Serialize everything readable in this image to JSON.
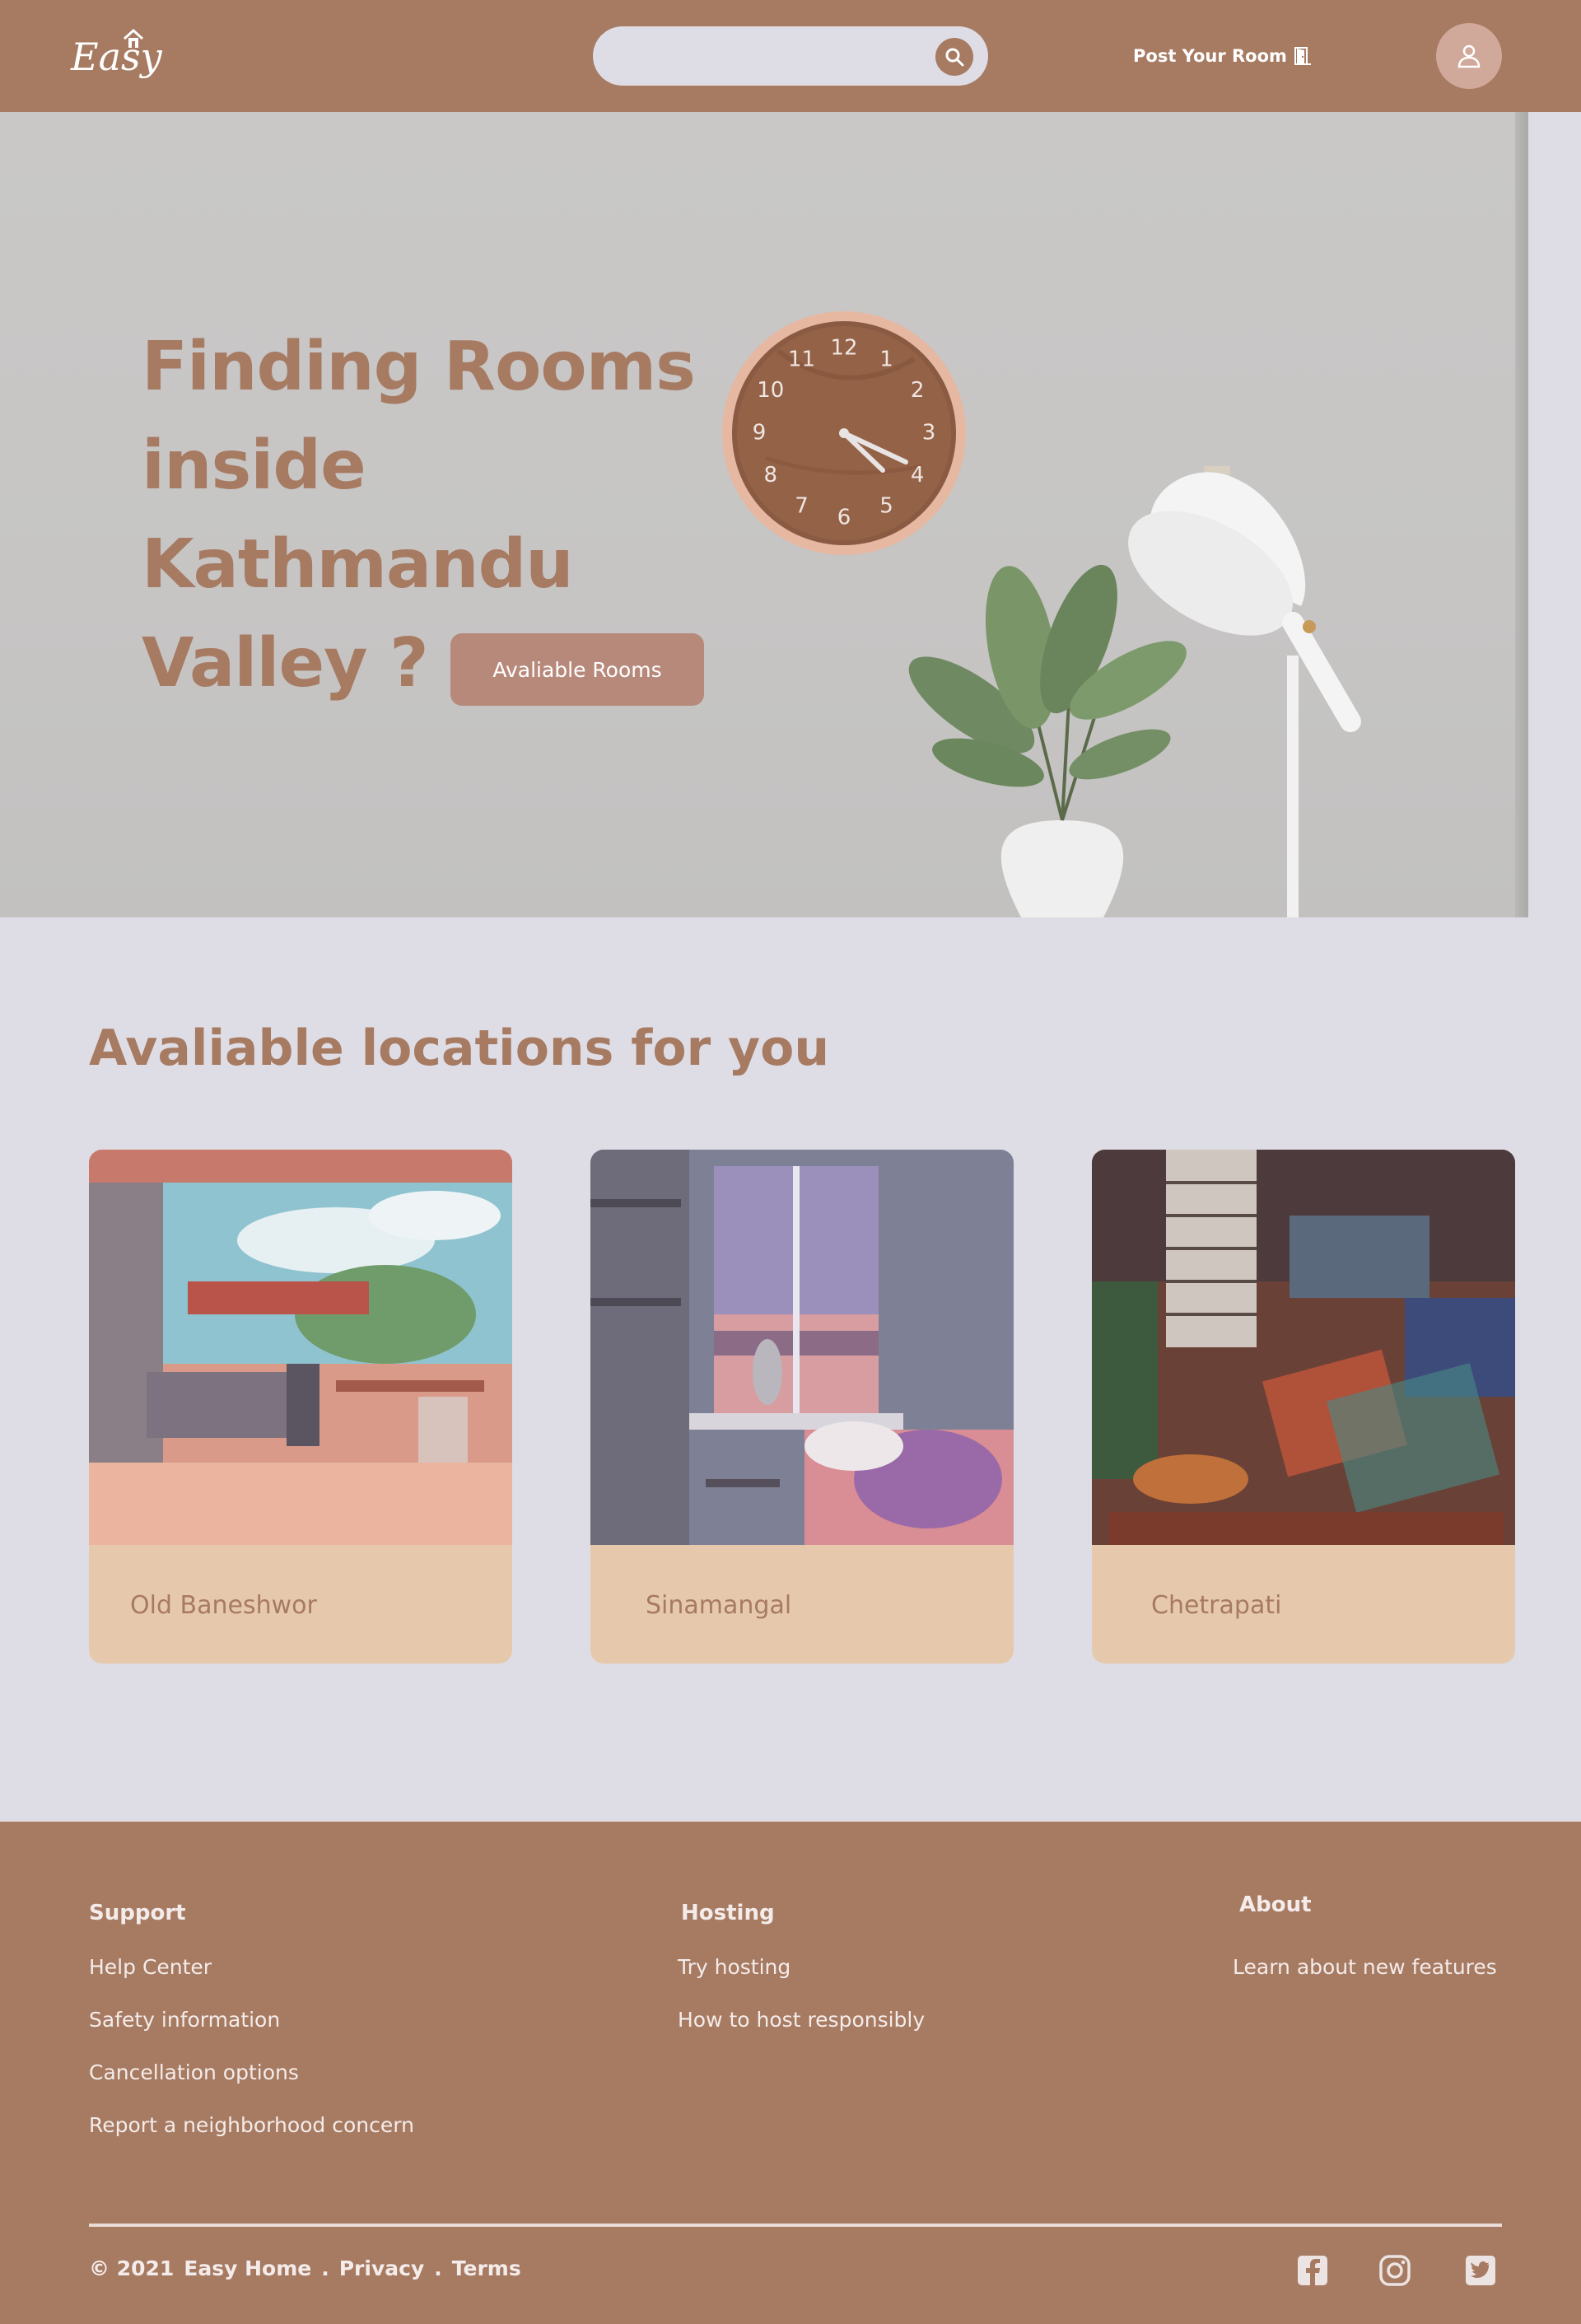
{
  "colors": {
    "brand_brown": "#a77a62",
    "page_bg": "#dedde5",
    "card_bg": "#e6c9ac",
    "button_bg": "#b7897a"
  },
  "header": {
    "logo_text": "Easy",
    "search_placeholder": "",
    "search_icon": "search-icon",
    "post_room_label": "Post Your Room",
    "post_room_icon": "door-icon",
    "profile_icon": "user-icon"
  },
  "hero": {
    "title_lines": [
      "Finding Rooms",
      "inside",
      "Kathmandu",
      "Valley ?"
    ],
    "button_label": "Avaliable Rooms",
    "clock_numbers": [
      "12",
      "1",
      "2",
      "3",
      "4",
      "5",
      "6",
      "7",
      "8",
      "9",
      "10",
      "11"
    ]
  },
  "locations": {
    "title": "Avaliable locations for you",
    "items": [
      {
        "name": "Old Baneshwor"
      },
      {
        "name": "Sinamangal"
      },
      {
        "name": "Chetrapati"
      }
    ]
  },
  "footer": {
    "support": {
      "title": "Support",
      "links": [
        "Help Center",
        "Safety information",
        "Cancellation options",
        "Report a neighborhood concern"
      ]
    },
    "hosting": {
      "title": "Hosting",
      "links": [
        "Try hosting",
        "How to host responsibly"
      ]
    },
    "about": {
      "title": "About",
      "links": [
        "Learn about new features"
      ]
    },
    "copyright": "© 2021",
    "brand": "Easy Home",
    "sep": ".",
    "privacy": "Privacy",
    "terms": "Terms",
    "social_icons": [
      "facebook-icon",
      "instagram-icon",
      "twitter-icon"
    ]
  }
}
